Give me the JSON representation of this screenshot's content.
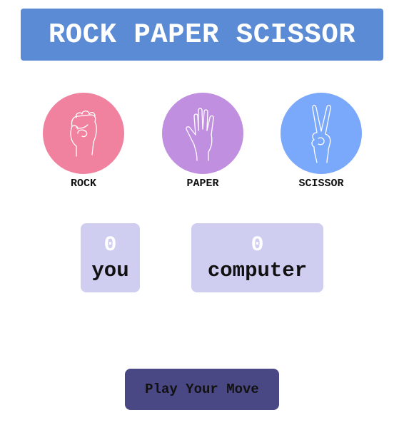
{
  "app": {
    "title": "ROCK PAPER SCISSOR"
  },
  "choices": [
    {
      "label": "ROCK",
      "color": "#f082a0",
      "icon": "fist-icon"
    },
    {
      "label": "PAPER",
      "color": "#c08fe0",
      "icon": "open-hand-icon"
    },
    {
      "label": "SCISSOR",
      "color": "#7aa8fb",
      "icon": "peace-hand-icon"
    }
  ],
  "scores": {
    "you": {
      "value": "0",
      "label": "you"
    },
    "computer": {
      "value": "0",
      "label": "computer"
    }
  },
  "actions": {
    "play_label": "Play Your Move"
  },
  "colors": {
    "title_bg": "#5b8bd4",
    "score_bg": "#cfcdf0",
    "button_bg": "#4a4785"
  }
}
